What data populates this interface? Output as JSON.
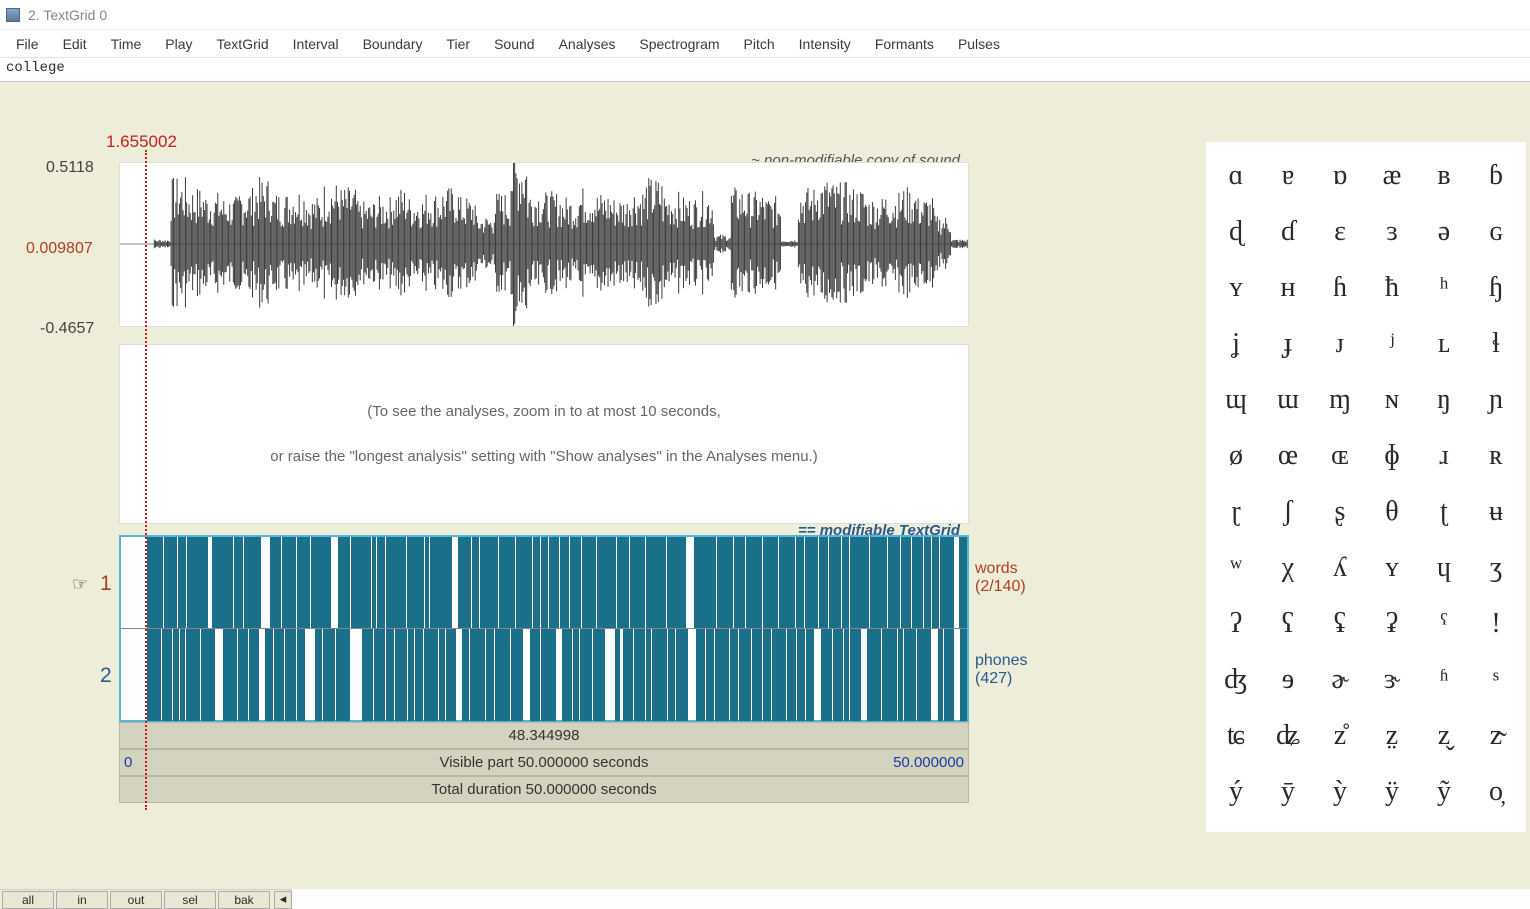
{
  "window": {
    "title": "2. TextGrid 0"
  },
  "menu": [
    "File",
    "Edit",
    "Time",
    "Play",
    "TextGrid",
    "Interval",
    "Boundary",
    "Tier",
    "Sound",
    "Analyses",
    "Spectrogram",
    "Pitch",
    "Intensity",
    "Formants",
    "Pulses"
  ],
  "input_text": "college",
  "cursor": {
    "time": "1.655002"
  },
  "waveform": {
    "title": "~ non-modifiable copy of sound",
    "y_max": "0.5118",
    "y_mid": "0.009807",
    "y_min": "-0.4657"
  },
  "analysis": {
    "line1": "(To see the analyses, zoom in to at most 10 seconds,",
    "line2": "or raise the \"longest analysis\" setting with \"Show analyses\" in the Analyses menu.)"
  },
  "textgrid": {
    "label": "== modifiable TextGrid",
    "pointer": "☞",
    "tier1_num": "1",
    "tier2_num": "2",
    "tier1_name": "words",
    "tier1_count": "(2/140)",
    "tier2_name": "phones",
    "tier2_count": "(427)"
  },
  "bars": {
    "sel_duration": "48.344998",
    "visible_label": "Visible part 50.000000 seconds",
    "visible_start": "0",
    "visible_end": "50.000000",
    "total_label": "Total duration 50.000000 seconds"
  },
  "footer": {
    "all": "all",
    "in": "in",
    "out": "out",
    "sel": "sel",
    "bak": "bak",
    "scroll_left": "◂"
  },
  "ipa": [
    "ɑ",
    "ɐ",
    "ɒ",
    "æ",
    "ʙ",
    "ɓ",
    "ɖ",
    "ɗ",
    "ɛ",
    "ɜ",
    "ə",
    "ɢ",
    "ʏ",
    "ʜ",
    "ɦ",
    "ħ",
    "ʰ",
    "ɧ",
    "ʝ",
    "ɟ",
    "ᴊ",
    "ʲ",
    "ʟ",
    "ɬ",
    "ɰ",
    "ɯ",
    "ɱ",
    "ɴ",
    "ŋ",
    "ɲ",
    "ø",
    "œ",
    "ɶ",
    "ɸ",
    "ɹ",
    "ʀ",
    "ɽ",
    "ʃ",
    "ʂ",
    "θ",
    "ʈ",
    "ʉ",
    "ʷ",
    "χ",
    "ʎ",
    "ʏ",
    "ɥ",
    "ʒ",
    "ʔ",
    "ʕ",
    "ʢ",
    "ʡ",
    "ˤ",
    "!",
    "ʤ",
    "ɘ",
    "ɚ",
    "ɝ",
    "ʱ",
    "ˢ",
    "ʨ",
    "ʥ",
    "z̊",
    "z̤",
    "z̬",
    "z̴",
    "ý",
    "ȳ",
    "ỳ",
    "ÿ",
    "ỹ",
    "o̦"
  ]
}
